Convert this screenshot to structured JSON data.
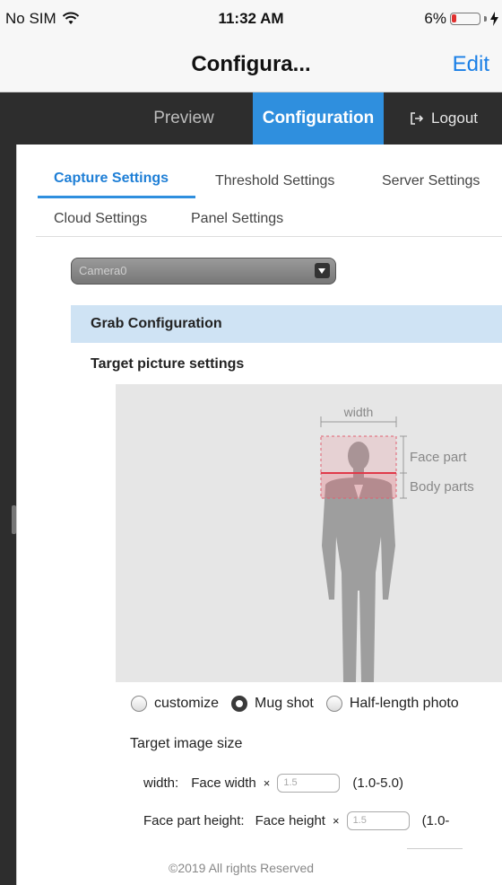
{
  "status_bar": {
    "carrier": "No SIM",
    "time": "11:32 AM",
    "battery": "6%",
    "battery_level": 0.06
  },
  "nav": {
    "title": "Configura...",
    "edit": "Edit"
  },
  "menu": {
    "preview": "Preview",
    "configuration": "Configuration",
    "logout": "Logout"
  },
  "tabs": [
    "Capture Settings",
    "Threshold Settings",
    "Server Settings",
    "Cloud Settings",
    "Panel Settings"
  ],
  "active_tab": "Capture Settings",
  "camera_select": {
    "value": "Camera0"
  },
  "section_title": "Grab Configuration",
  "target_picture_title": "Target picture settings",
  "diagram": {
    "width_label": "width",
    "face_label": "Face part",
    "body_label": "Body parts"
  },
  "radios": [
    {
      "label": "customize",
      "checked": false
    },
    {
      "label": "Mug shot",
      "checked": true
    },
    {
      "label": "Half-length photo",
      "checked": false
    }
  ],
  "target_size_title": "Target image size",
  "width_row": {
    "label": "width:",
    "sublabel": "Face width",
    "mult": "×",
    "value": "1.5",
    "range": "(1.0-5.0)"
  },
  "face_row": {
    "label": "Face part height:",
    "sublabel": "Face height",
    "mult": "×",
    "value": "1.5",
    "range": "(1.0-"
  },
  "footer": "©2019 All rights Reserved",
  "colors": {
    "accent": "#2f8fde",
    "menu_bg": "#2d2d2d",
    "section_bg": "#cfe3f4",
    "edit": "#1a7fe6"
  }
}
